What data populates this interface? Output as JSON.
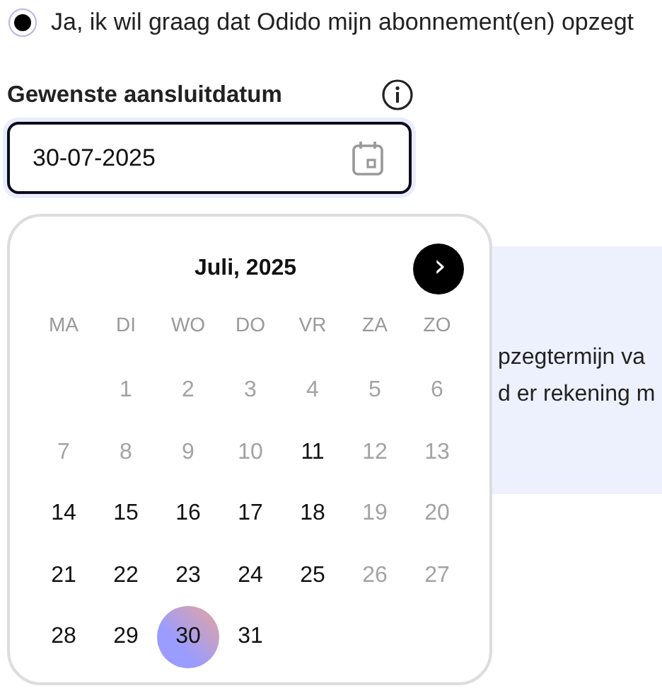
{
  "radio": {
    "label": "Ja, ik wil graag dat Odido mijn abonnement(en) opzegt",
    "selected": true
  },
  "date_field": {
    "label": "Gewenste aansluitdatum",
    "value": "30-07-2025"
  },
  "info_panel": {
    "lines": [
      "pzegtermijn va",
      "d er rekening m"
    ]
  },
  "calendar": {
    "month": "Juli, 2025",
    "next": "›",
    "weekdays": [
      "MA",
      "DI",
      "WO",
      "DO",
      "VR",
      "ZA",
      "ZO"
    ],
    "weeks": [
      [
        {
          "day": "1",
          "disabled": true,
          "selected": false
        },
        {
          "day": "2",
          "disabled": true,
          "selected": false
        },
        {
          "day": "3",
          "disabled": true,
          "selected": false
        },
        {
          "day": "4",
          "disabled": true,
          "selected": false
        },
        {
          "day": "5",
          "disabled": true,
          "selected": false
        },
        {
          "day": "6",
          "disabled": true,
          "selected": false
        }
      ],
      [
        {
          "day": "7",
          "disabled": true,
          "selected": false
        },
        {
          "day": "8",
          "disabled": true,
          "selected": false
        },
        {
          "day": "9",
          "disabled": true,
          "selected": false
        },
        {
          "day": "10",
          "disabled": true,
          "selected": false
        },
        {
          "day": "11",
          "disabled": false,
          "selected": false
        },
        {
          "day": "12",
          "disabled": true,
          "selected": false
        },
        {
          "day": "13",
          "disabled": true,
          "selected": false
        }
      ],
      [
        {
          "day": "14",
          "disabled": false,
          "selected": false
        },
        {
          "day": "15",
          "disabled": false,
          "selected": false
        },
        {
          "day": "16",
          "disabled": false,
          "selected": false
        },
        {
          "day": "17",
          "disabled": false,
          "selected": false
        },
        {
          "day": "18",
          "disabled": false,
          "selected": false
        },
        {
          "day": "19",
          "disabled": true,
          "selected": false
        },
        {
          "day": "20",
          "disabled": true,
          "selected": false
        }
      ],
      [
        {
          "day": "21",
          "disabled": false,
          "selected": false
        },
        {
          "day": "22",
          "disabled": false,
          "selected": false
        },
        {
          "day": "23",
          "disabled": false,
          "selected": false
        },
        {
          "day": "24",
          "disabled": false,
          "selected": false
        },
        {
          "day": "25",
          "disabled": false,
          "selected": false
        },
        {
          "day": "26",
          "disabled": true,
          "selected": false
        },
        {
          "day": "27",
          "disabled": true,
          "selected": false
        }
      ],
      [
        {
          "day": "28",
          "disabled": false,
          "selected": false
        },
        {
          "day": "29",
          "disabled": false,
          "selected": false
        },
        {
          "day": "30",
          "disabled": false,
          "selected": true
        },
        {
          "day": "31",
          "disabled": false,
          "selected": false
        }
      ]
    ]
  }
}
